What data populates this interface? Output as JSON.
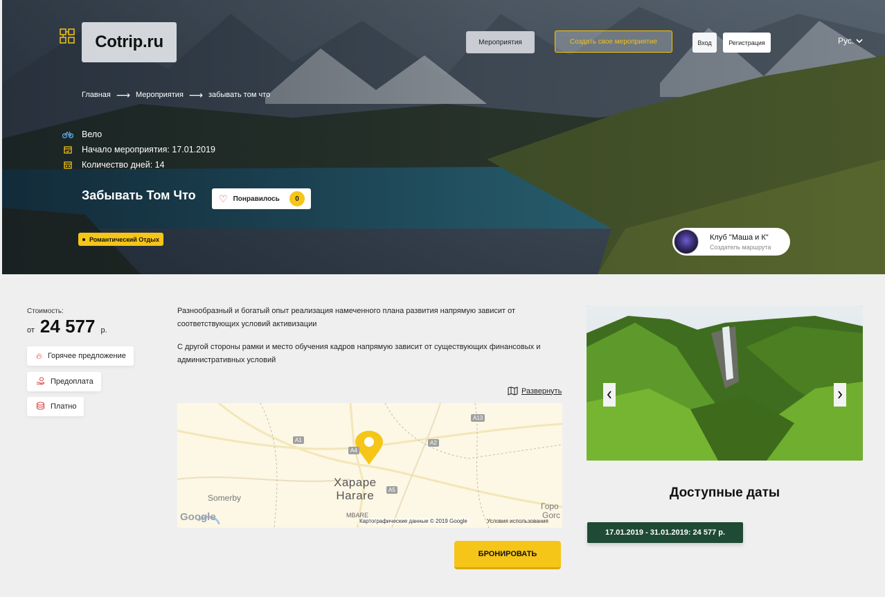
{
  "site": {
    "logo_text": "Cotrip.ru"
  },
  "nav": {
    "events": "Мероприятия",
    "create_event": "Создать свое мероприятие",
    "login": "Вход",
    "register": "Регистрация",
    "language": "Рус."
  },
  "breadcrumb": [
    "Главная",
    "Мероприятия",
    "забывать том что"
  ],
  "event": {
    "category": "Вело",
    "start": "Начало мероприятия: 17.01.2019",
    "days": "Количество дней: 14",
    "title": "Забывать Том Что",
    "like_label": "Понравилось",
    "like_count": "0",
    "tag": "Романтический Отдых"
  },
  "organizer": {
    "name": "Клуб \"Маша и К\"",
    "role": "Создатель маршрута"
  },
  "price": {
    "label": "Стоимость:",
    "from": "от",
    "value": "24 577",
    "currency": "р."
  },
  "features": [
    "Горячее предложение",
    "Предоплата",
    "Платно"
  ],
  "description": [
    "Разнообразный и богатый опыт реализация намеченного плана развития напрямую зависит от соответствующих условий активизации",
    "С другой стороны рамки и место обучения кадров напрямую зависит от существующих финансовых и административных условий"
  ],
  "map": {
    "expand": "Развернуть",
    "city_line1": "Хараре",
    "city_line2": "Harare",
    "somerby": "Somerby",
    "gor1": "Горо",
    "gor2": "Gorc",
    "mbare": "MBARE",
    "roads": [
      "A13",
      "A1",
      "A2",
      "A4",
      "A5"
    ],
    "google": "Google",
    "attribution": "Картографические данные © 2019 Google",
    "terms": "Условия использования"
  },
  "book_button": "БРОНИРОВАТЬ",
  "dates": {
    "title": "Доступные даты",
    "items": [
      "17.01.2019 - 31.01.2019: 24 577 р."
    ]
  },
  "colors": {
    "accent": "#f5c518",
    "date_chip": "#1f4a34",
    "hot": "#e04545"
  },
  "icons": {
    "category": "bicycle-icon",
    "start": "calendar-icon",
    "days": "calendar-icon",
    "like": "heart-icon",
    "expand": "map-icon"
  }
}
